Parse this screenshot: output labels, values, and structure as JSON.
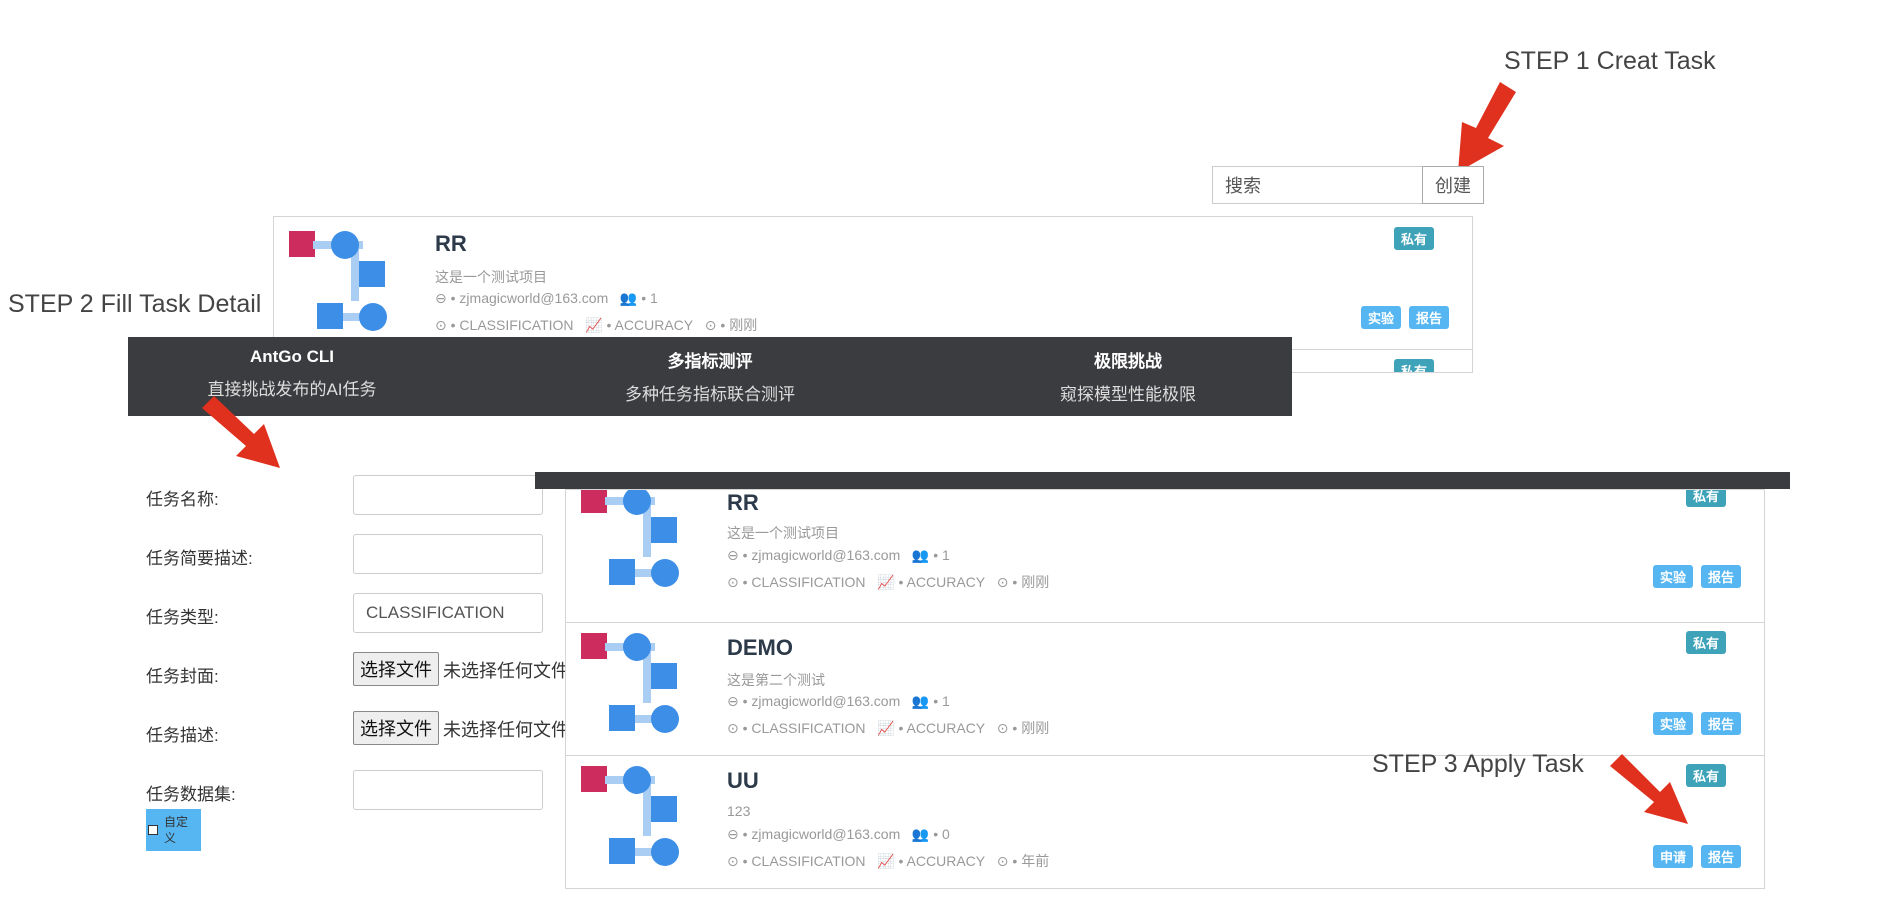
{
  "steps": {
    "step1": "STEP 1 Creat Task",
    "step2": "STEP 2 Fill Task Detail",
    "step3": "STEP 3 Apply Task"
  },
  "search": {
    "placeholder": "搜索",
    "create_label": "创建"
  },
  "top_card": {
    "title": "RR",
    "desc": "这是一个测试项目",
    "email": "zjmagicworld@163.com",
    "members": "1",
    "type": "CLASSIFICATION",
    "metric": "ACCURACY",
    "time": "刚刚",
    "badge_private": "私有",
    "badge_exp": "实验",
    "badge_report": "报告",
    "badge_private_next": "私有"
  },
  "banner": {
    "features": [
      {
        "title": "AntGo CLI",
        "subtitle": "直接挑战发布的AI任务"
      },
      {
        "title": "多指标测评",
        "subtitle": "多种任务指标联合测评"
      },
      {
        "title": "极限挑战",
        "subtitle": "窥探模型性能极限"
      }
    ]
  },
  "form": {
    "name_label": "任务名称:",
    "brief_label": "任务简要描述:",
    "type_label": "任务类型:",
    "type_value": "CLASSIFICATION",
    "cover_label": "任务封面:",
    "desc_label": "任务描述:",
    "dataset_label": "任务数据集:",
    "file_button": "选择文件",
    "file_none": "未选择任何文件",
    "custom_label": "自定义"
  },
  "projects": [
    {
      "title": "RR",
      "desc": "这是一个测试项目",
      "email": "zjmagicworld@163.com",
      "members": "1",
      "type": "CLASSIFICATION",
      "metric": "ACCURACY",
      "time": "刚刚",
      "badge_private": "私有",
      "badge_action": "实验",
      "badge_report": "报告"
    },
    {
      "title": "DEMO",
      "desc": "这是第二个测试",
      "email": "zjmagicworld@163.com",
      "members": "1",
      "type": "CLASSIFICATION",
      "metric": "ACCURACY",
      "time": "刚刚",
      "badge_private": "私有",
      "badge_action": "实验",
      "badge_report": "报告"
    },
    {
      "title": "UU",
      "desc": "123",
      "email": "zjmagicworld@163.com",
      "members": "0",
      "type": "CLASSIFICATION",
      "metric": "ACCURACY",
      "time": "年前",
      "badge_private": "私有",
      "badge_action": "申请",
      "badge_report": "报告"
    }
  ],
  "colors": {
    "arrow": "#e0311f",
    "accent": "#55b6f2",
    "private_badge": "#3ea2b8",
    "banner_bg": "#3b3c3f"
  }
}
